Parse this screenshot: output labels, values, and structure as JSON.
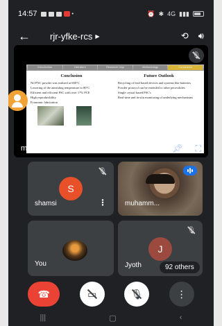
{
  "status": {
    "time": "14:57",
    "network": "4G"
  },
  "header": {
    "meeting_code": "rjr-yfke-rcs"
  },
  "presentation": {
    "presenter_label": "muhammed is presenting",
    "slide": {
      "nav_items": [
        "Introduction",
        "Literature",
        "Research Gap",
        "Methodology",
        "Conclusion"
      ],
      "left_title": "Conclusion",
      "left_points": [
        "Nil PNC powder was realized at 600°C",
        "Lowering of the annealing temperature to 80°C",
        "Efficient and efficient PSC with over 17% PCE",
        "High reproducibility",
        "Economic fabrication"
      ],
      "right_title": "Future Outlook",
      "right_points": [
        "Recycling of lead based devices and systems like batteries",
        "Powder protocol can be extended to other perovskites",
        "Single crystal based PSC's",
        "Real-time and in-situ monitoring of underlying mechanisms"
      ]
    }
  },
  "participants": [
    {
      "name": "shamsi",
      "initial": "S",
      "color": "#e8502a"
    },
    {
      "name": "muhamm..."
    },
    {
      "name": "You"
    },
    {
      "name": "Jyoth",
      "initial": "J",
      "color": "#9c4a40"
    }
  ],
  "others_label": "92 others"
}
